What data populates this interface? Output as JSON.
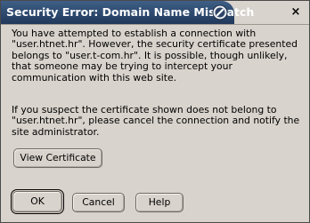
{
  "window": {
    "title": "Security Error: Domain Name Mismatch",
    "close_label": "×",
    "title_icon": "security-warning-icon"
  },
  "message": {
    "paragraph1": "You have attempted to establish a connection with \"user.htnet.hr\". However, the security certificate presented belongs to \"user.t-com.hr\". It is possible, though unlikely, that someone may be trying to intercept your communication with this web site.",
    "paragraph2": "If you suspect the certificate shown does not belong to \"user.htnet.hr\", please cancel the connection and notify the site administrator."
  },
  "buttons": {
    "view_certificate": "View Certificate",
    "ok": "OK",
    "cancel": "Cancel",
    "help": "Help"
  },
  "colors": {
    "title_bar": "#2e4a70",
    "dialog_bg": "#d8d3cc"
  }
}
